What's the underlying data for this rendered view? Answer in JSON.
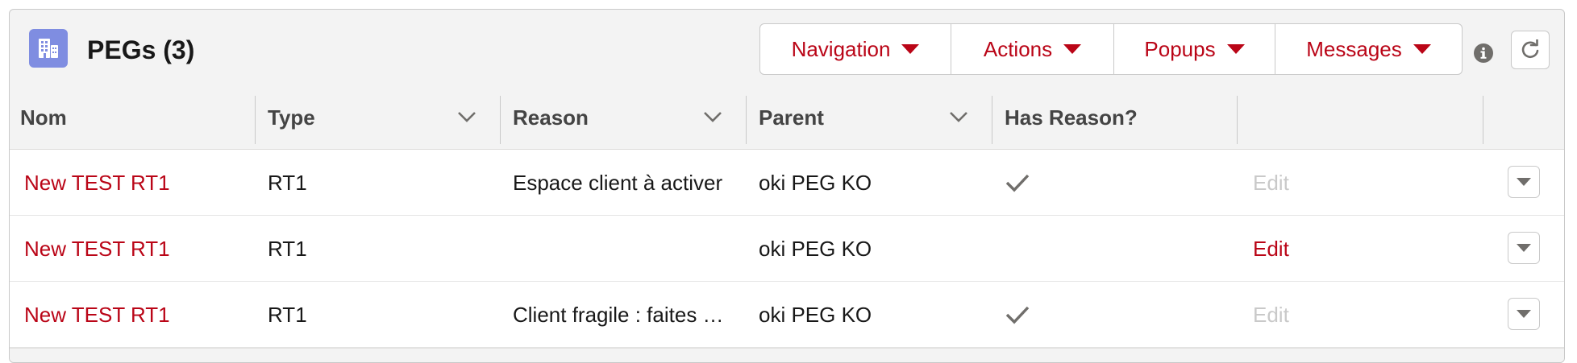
{
  "card": {
    "title": "PEGs (3)",
    "icon": "building-icon",
    "icon_color": "#7f8de1"
  },
  "toolbar": {
    "buttons": [
      {
        "label": "Navigation"
      },
      {
        "label": "Actions"
      },
      {
        "label": "Popups"
      },
      {
        "label": "Messages"
      }
    ]
  },
  "table": {
    "columns": [
      {
        "label": "Nom",
        "sortable": false
      },
      {
        "label": "Type",
        "sortable": true
      },
      {
        "label": "Reason",
        "sortable": true
      },
      {
        "label": "Parent",
        "sortable": true
      },
      {
        "label": "Has Reason?",
        "sortable": false
      },
      {
        "label": "",
        "sortable": false
      }
    ],
    "rows": [
      {
        "nom": "New TEST RT1",
        "type": "RT1",
        "reason": "Espace client à activer",
        "parent": "oki PEG KO",
        "has_reason": true,
        "edit_label": "Edit",
        "edit_enabled": false
      },
      {
        "nom": "New TEST RT1",
        "type": "RT1",
        "reason": "",
        "parent": "oki PEG KO",
        "has_reason": false,
        "edit_label": "Edit",
        "edit_enabled": true
      },
      {
        "nom": "New TEST RT1",
        "type": "RT1",
        "reason": "Client fragile : faites …",
        "parent": "oki PEG KO",
        "has_reason": true,
        "edit_label": "Edit",
        "edit_enabled": false
      }
    ]
  },
  "colors": {
    "brand_red": "#ba0517",
    "disabled": "#c9c9c9",
    "header_bg": "#f3f3f3"
  }
}
